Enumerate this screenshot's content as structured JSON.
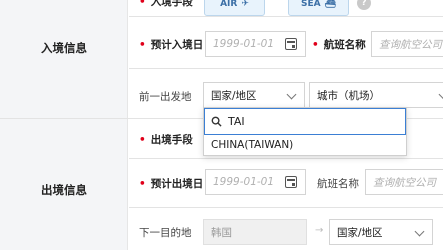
{
  "entry_section": {
    "title": "入境信息"
  },
  "exit_section": {
    "title": "出境信息"
  },
  "entry_mode": {
    "label": "入境手段",
    "buttons": [
      {
        "label": "AIR"
      },
      {
        "label": "SEA"
      }
    ],
    "help": "?"
  },
  "entry_date": {
    "label": "预计入境日",
    "placeholder": "1999-01-01"
  },
  "entry_flight": {
    "label": "航班名称",
    "placeholder": "查询航空公司"
  },
  "prev_departure": {
    "label": "前一出发地",
    "country_value": "国家/地区",
    "city_value": "城市（机场）"
  },
  "country_dropdown": {
    "search_value": "TAI",
    "options": [
      "CHINA(TAIWAN)"
    ]
  },
  "exit_mode": {
    "label": "出境手段"
  },
  "exit_date": {
    "label": "预计出境日",
    "placeholder": "1999-01-01"
  },
  "exit_flight": {
    "label": "航班名称",
    "placeholder": "查询航空公司"
  },
  "next_destination": {
    "label": "下一目的地",
    "from_value": "韩国",
    "country_value": "国家/地区"
  },
  "colors": {
    "required": "#e0001a",
    "focus": "#3b7fd4",
    "mode_button_bg": "#e8f3fc"
  }
}
